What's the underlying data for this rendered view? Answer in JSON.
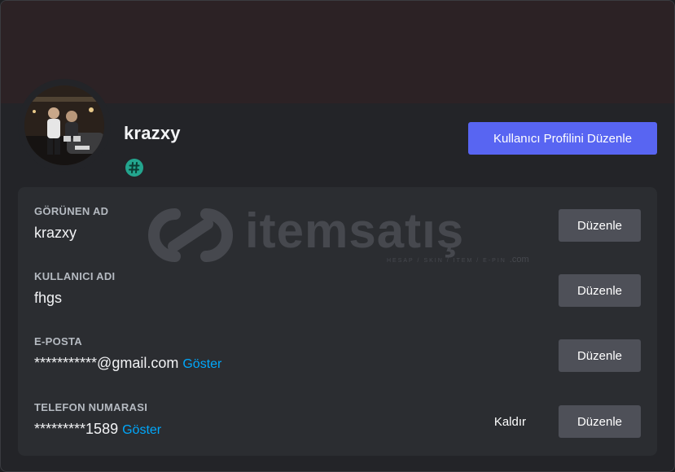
{
  "profile": {
    "username": "krazxy",
    "edit_profile_label": "Kullanıcı Profilini Düzenle",
    "badge_icon": "hashtag-badge-icon",
    "banner_color": "#2c2225",
    "accent_color": "#5865f2"
  },
  "rows": [
    {
      "label": "GÖRÜNEN AD",
      "value": "krazxy",
      "edit_label": "Düzenle"
    },
    {
      "label": "KULLANICI ADI",
      "value": "fhgs",
      "edit_label": "Düzenle"
    },
    {
      "label": "E-POSTA",
      "value": "***********@gmail.com",
      "reveal_label": "Göster",
      "edit_label": "Düzenle"
    },
    {
      "label": "TELEFON NUMARASI",
      "value": "*********1589",
      "reveal_label": "Göster",
      "remove_label": "Kaldır",
      "edit_label": "Düzenle"
    }
  ],
  "watermark": {
    "brand": "itemsatış",
    "tagline": "HESAP / SKIN / ITEM / E-PIN",
    "domain": ".com"
  }
}
